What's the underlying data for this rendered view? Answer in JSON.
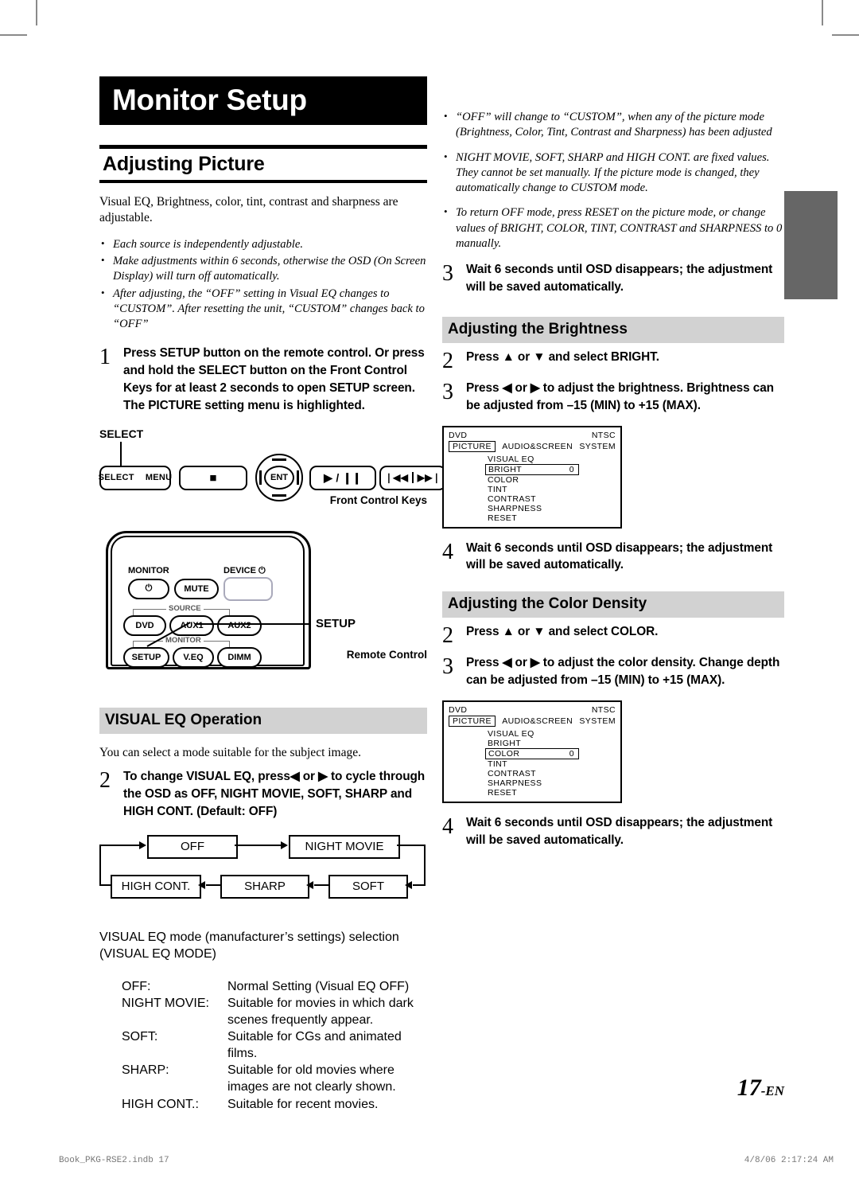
{
  "chapter": {
    "title": "Monitor Setup"
  },
  "section": {
    "title": "Adjusting Picture",
    "intro": "Visual EQ, Brightness, color, tint, contrast and sharpness are adjustable.",
    "notes": [
      "Each source is independently adjustable.",
      "Make adjustments within 6 seconds, otherwise the OSD (On Screen Display) will turn off automatically.",
      "After adjusting, the “OFF” setting in Visual EQ changes to “CUSTOM”. After resetting the unit, “CUSTOM” changes back to “OFF”"
    ]
  },
  "step1": {
    "num": "1",
    "text": "Press SETUP button on the remote control. Or press and hold the SELECT button on the Front Control Keys for at least 2 seconds to open SETUP screen. The PICTURE setting menu is highlighted."
  },
  "front_keys": {
    "select_label": "SELECT",
    "caption": "Front Control Keys",
    "keys": {
      "select": "SELECT",
      "menu": "MENU",
      "stop": "■",
      "ent": "ENT",
      "play_pause": "▶ / ❙❙",
      "prev": "❘◀◀",
      "next": "▶▶❘"
    }
  },
  "remote": {
    "caption": "Remote Control",
    "monitor_label": "MONITOR",
    "device_label": "DEVICE",
    "device_power_icon": "⏻",
    "monitor_power_icon": "⏻",
    "mute": "MUTE",
    "source_group": "SOURCE",
    "monitor_group": "MONITOR",
    "dvd": "DVD",
    "aux1": "AUX1",
    "aux2": "AUX2",
    "setup": "SETUP",
    "veq": "V.EQ",
    "dimm": "DIMM",
    "callout": "SETUP"
  },
  "visual_eq": {
    "heading": "VISUAL EQ Operation",
    "intro": "You can select a mode suitable for the subject image.",
    "step2_num": "2",
    "step2_text": "To change VISUAL EQ, press◀ or ▶ to cycle through the OSD as OFF, NIGHT MOVIE, SOFT, SHARP and HIGH CONT. (Default: OFF)",
    "flow": {
      "off": "OFF",
      "night_movie": "NIGHT MOVIE",
      "soft": "SOFT",
      "sharp": "SHARP",
      "high_cont": "HIGH CONT."
    },
    "mode_heading": "VISUAL EQ mode (manufacturer’s settings) selection (VISUAL EQ MODE)",
    "modes": [
      {
        "term": "OFF:",
        "desc": "Normal Setting (Visual EQ OFF)"
      },
      {
        "term": "NIGHT MOVIE:",
        "desc": "Suitable for movies in which dark scenes frequently appear."
      },
      {
        "term": "SOFT:",
        "desc": "Suitable for CGs and animated films."
      },
      {
        "term": "SHARP:",
        "desc": "Suitable for old movies where images are not clearly shown."
      },
      {
        "term": "HIGH CONT.:",
        "desc": "Suitable for recent movies."
      }
    ]
  },
  "right_notes": [
    "“OFF” will change to “CUSTOM”, when any of the picture mode (Brightness, Color, Tint, Contrast and Sharpness) has been adjusted",
    "NIGHT MOVIE, SOFT, SHARP and HIGH CONT. are fixed values. They cannot be set manually. If the picture mode is changed, they automatically change to CUSTOM mode.",
    "To return OFF mode, press RESET on the picture mode, or change values of BRIGHT, COLOR, TINT, CONTRAST and SHARPNESS to 0 manually."
  ],
  "step3_top": {
    "num": "3",
    "text": "Wait 6 seconds until OSD disappears; the adjustment will be saved automatically."
  },
  "brightness": {
    "heading": "Adjusting the Brightness",
    "step2_num": "2",
    "step2_text": "Press ▲ or ▼ and select BRIGHT.",
    "step3_num": "3",
    "step3_text": "Press ◀ or ▶ to adjust the brightness. Brightness can be adjusted from –15 (MIN) to +15 (MAX).",
    "step4_num": "4",
    "step4_text": "Wait 6 seconds until OSD disappears; the adjustment will be saved automatically."
  },
  "color_density": {
    "heading": "Adjusting the Color Density",
    "step2_num": "2",
    "step2_text": "Press ▲ or ▼ and select COLOR.",
    "step3_num": "3",
    "step3_text": "Press ◀ or ▶ to adjust the color density. Change depth can be adjusted from –15 (MIN) to +15 (MAX).",
    "step4_num": "4",
    "step4_text": "Wait 6 seconds until OSD disappears; the adjustment will be saved automatically."
  },
  "osd": {
    "source": "DVD",
    "system": "NTSC",
    "tabs": [
      "PICTURE",
      "AUDIO&SCREEN",
      "SYSTEM"
    ],
    "selected_tab": "PICTURE",
    "items": [
      "VISUAL EQ",
      "BRIGHT",
      "COLOR",
      "TINT",
      "CONTRAST",
      "SHARPNESS",
      "RESET"
    ],
    "bright_selected": "BRIGHT",
    "bright_value": "0",
    "color_selected": "COLOR",
    "color_value": "0"
  },
  "footer": {
    "page_number": "17",
    "page_suffix": "-EN",
    "print_file": "Book_PKG-RSE2.indb   17",
    "print_stamp": "4/8/06   2:17:24 AM"
  }
}
